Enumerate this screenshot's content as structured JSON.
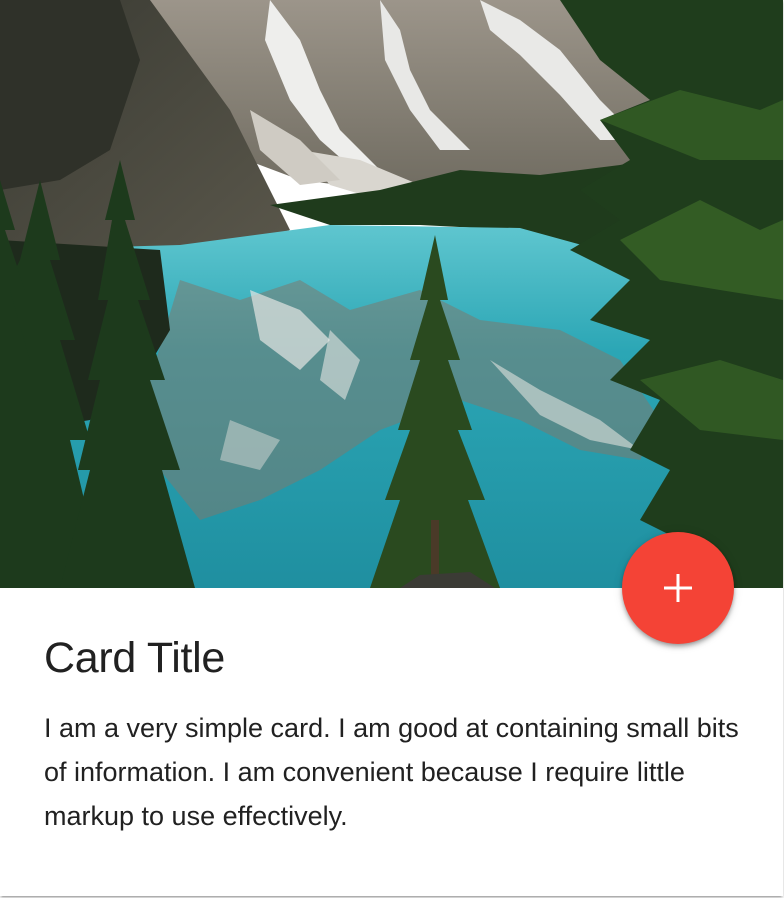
{
  "card": {
    "image_alt": "Mountain lake",
    "title": "Card Title",
    "text": "I am a very simple card. I am good at containing small bits of information. I am convenient because I require little markup to use effectively."
  },
  "fab": {
    "icon": "add-icon",
    "color": "#f44336"
  },
  "colors": {
    "lake": "#2aa4b4",
    "forest": "#1f3a1a",
    "mountain": "#8a8478",
    "snow": "#f2f2f0",
    "sky": "#cfe3f5"
  }
}
